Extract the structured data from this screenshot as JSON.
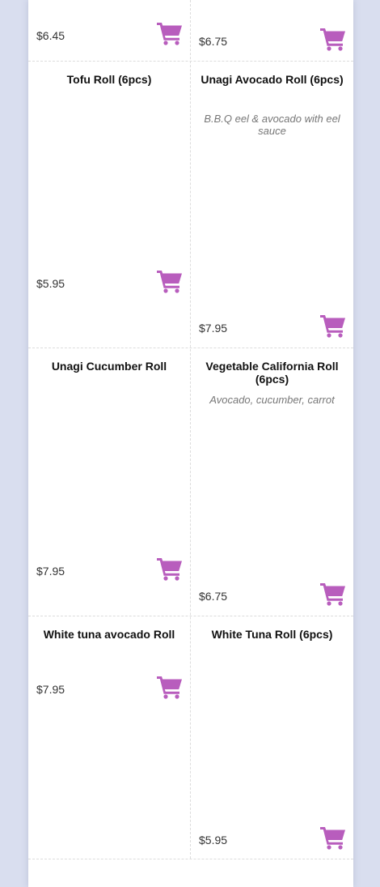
{
  "theme": {
    "accent": "#b85dbd",
    "background": "#d9deef"
  },
  "items": [
    {
      "name": "",
      "description": "",
      "price": "$6.45",
      "cart_icon": "shopping-cart-icon"
    },
    {
      "name": "",
      "description": "",
      "price": "$6.75",
      "cart_icon": "shopping-cart-icon"
    },
    {
      "name": "Tofu Roll (6pcs)",
      "description": "",
      "price": "$5.95",
      "cart_icon": "shopping-cart-icon"
    },
    {
      "name": "Unagi Avocado Roll (6pcs)",
      "description": "B.B.Q eel & avocado with eel sauce",
      "price": "$7.95",
      "cart_icon": "shopping-cart-icon"
    },
    {
      "name": "Unagi Cucumber Roll",
      "description": "",
      "price": "$7.95",
      "cart_icon": "shopping-cart-icon"
    },
    {
      "name": "Vegetable California Roll (6pcs)",
      "description": "Avocado, cucumber, carrot",
      "price": "$6.75",
      "cart_icon": "shopping-cart-icon"
    },
    {
      "name": "White tuna avocado Roll",
      "description": "",
      "price": "$7.95",
      "cart_icon": "shopping-cart-icon"
    },
    {
      "name": "White Tuna Roll (6pcs)",
      "description": "",
      "price": "$5.95",
      "cart_icon": "shopping-cart-icon"
    }
  ]
}
